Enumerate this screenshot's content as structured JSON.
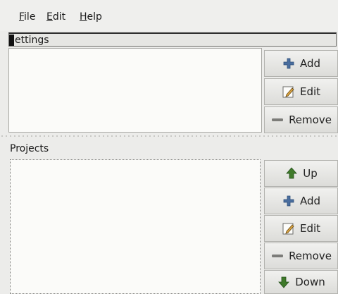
{
  "menubar": {
    "items": [
      {
        "label": "File",
        "mnemonic": "F",
        "rest": "ile"
      },
      {
        "label": "Edit",
        "mnemonic": "E",
        "rest": "dit"
      },
      {
        "label": "Help",
        "mnemonic": "H",
        "rest": "elp"
      }
    ]
  },
  "settings": {
    "title": "ettings",
    "buttons": [
      {
        "label": "Add",
        "icon": "plus-icon"
      },
      {
        "label": "Edit",
        "icon": "edit-icon"
      },
      {
        "label": "Remove",
        "icon": "minus-icon"
      }
    ]
  },
  "projects": {
    "title": "Projects",
    "buttons": [
      {
        "label": "Up",
        "icon": "up-arrow-icon"
      },
      {
        "label": "Add",
        "icon": "plus-icon"
      },
      {
        "label": "Edit",
        "icon": "edit-icon"
      },
      {
        "label": "Remove",
        "icon": "minus-icon"
      },
      {
        "label": "Down",
        "icon": "down-arrow-icon"
      }
    ]
  },
  "colors": {
    "icon_blue": "#4a6e9f",
    "icon_green": "#3f7a2a",
    "icon_gray": "#7c7c79"
  }
}
